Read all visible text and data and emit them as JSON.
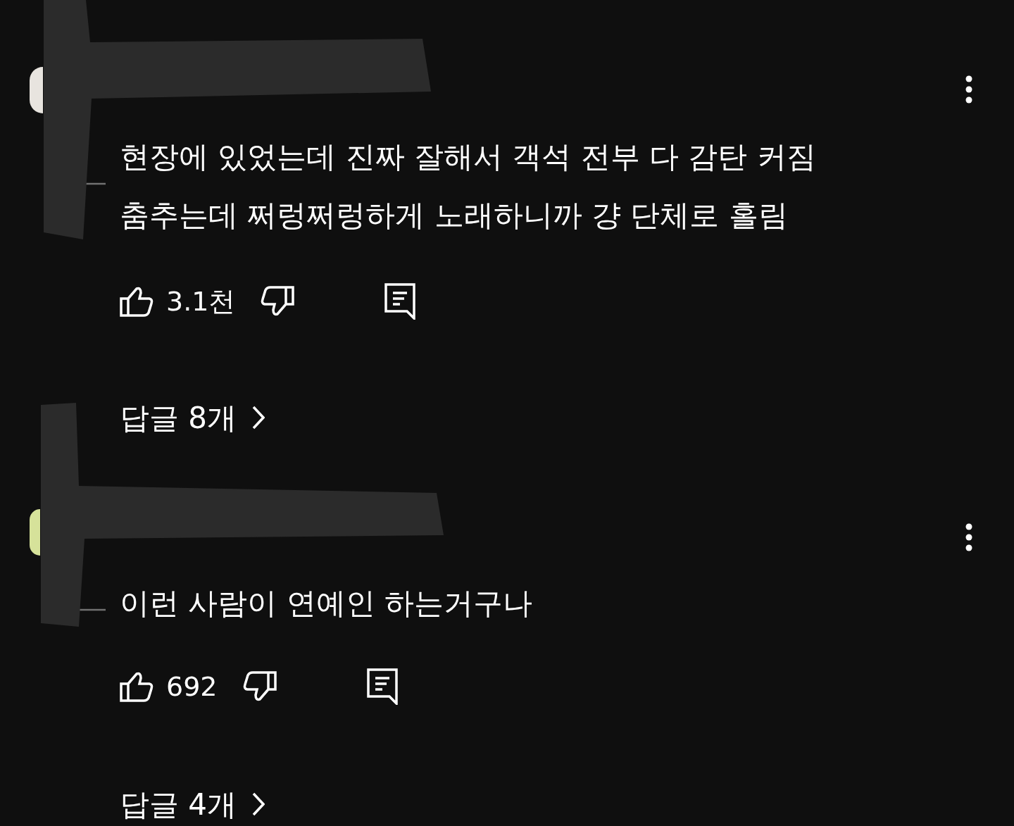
{
  "comments": [
    {
      "text_lines": [
        "현장에 있었는데 진짜 잘해서 객석 전부 다 감탄 커짐",
        "춤추는데 쩌렁쩌렁하게 노래하니까 걍 단체로 홀림"
      ],
      "likes": "3.1천",
      "replies": "답글 8개"
    },
    {
      "text_lines": [
        "이런 사람이 연예인 하는거구나"
      ],
      "likes": "692",
      "replies": "답글 4개"
    }
  ]
}
